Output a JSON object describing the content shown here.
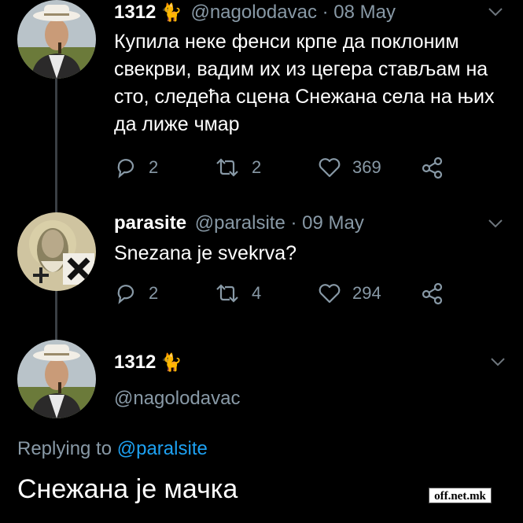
{
  "tweets": [
    {
      "name": "1312",
      "emoji": "🐈",
      "handle": "@nagolodavac",
      "separator": "·",
      "date": "08 May",
      "text": "Купила неке фенси крпе да поклоним свекрви, вадим их из цегера стављам на сто, следећа сцена Снежана села на њих да лиже чмар",
      "replies": "2",
      "retweets": "2",
      "likes": "369"
    },
    {
      "name": "parasite",
      "handle": "@paralsite",
      "separator": "·",
      "date": "09 May",
      "text": "Snezana je svekrva?",
      "replies": "2",
      "retweets": "4",
      "likes": "294"
    }
  ],
  "focused": {
    "name": "1312",
    "emoji": "🐈",
    "handle": "@nagolodavac",
    "replying_prefix": "Replying to",
    "replying_to": "@paralsite",
    "text": "Снежана је мачка"
  },
  "watermark": "off.net.mk",
  "colors": {
    "background": "#000000",
    "muted": "#8899a6",
    "link": "#1da1f2",
    "thread_line": "#3a3f44"
  }
}
